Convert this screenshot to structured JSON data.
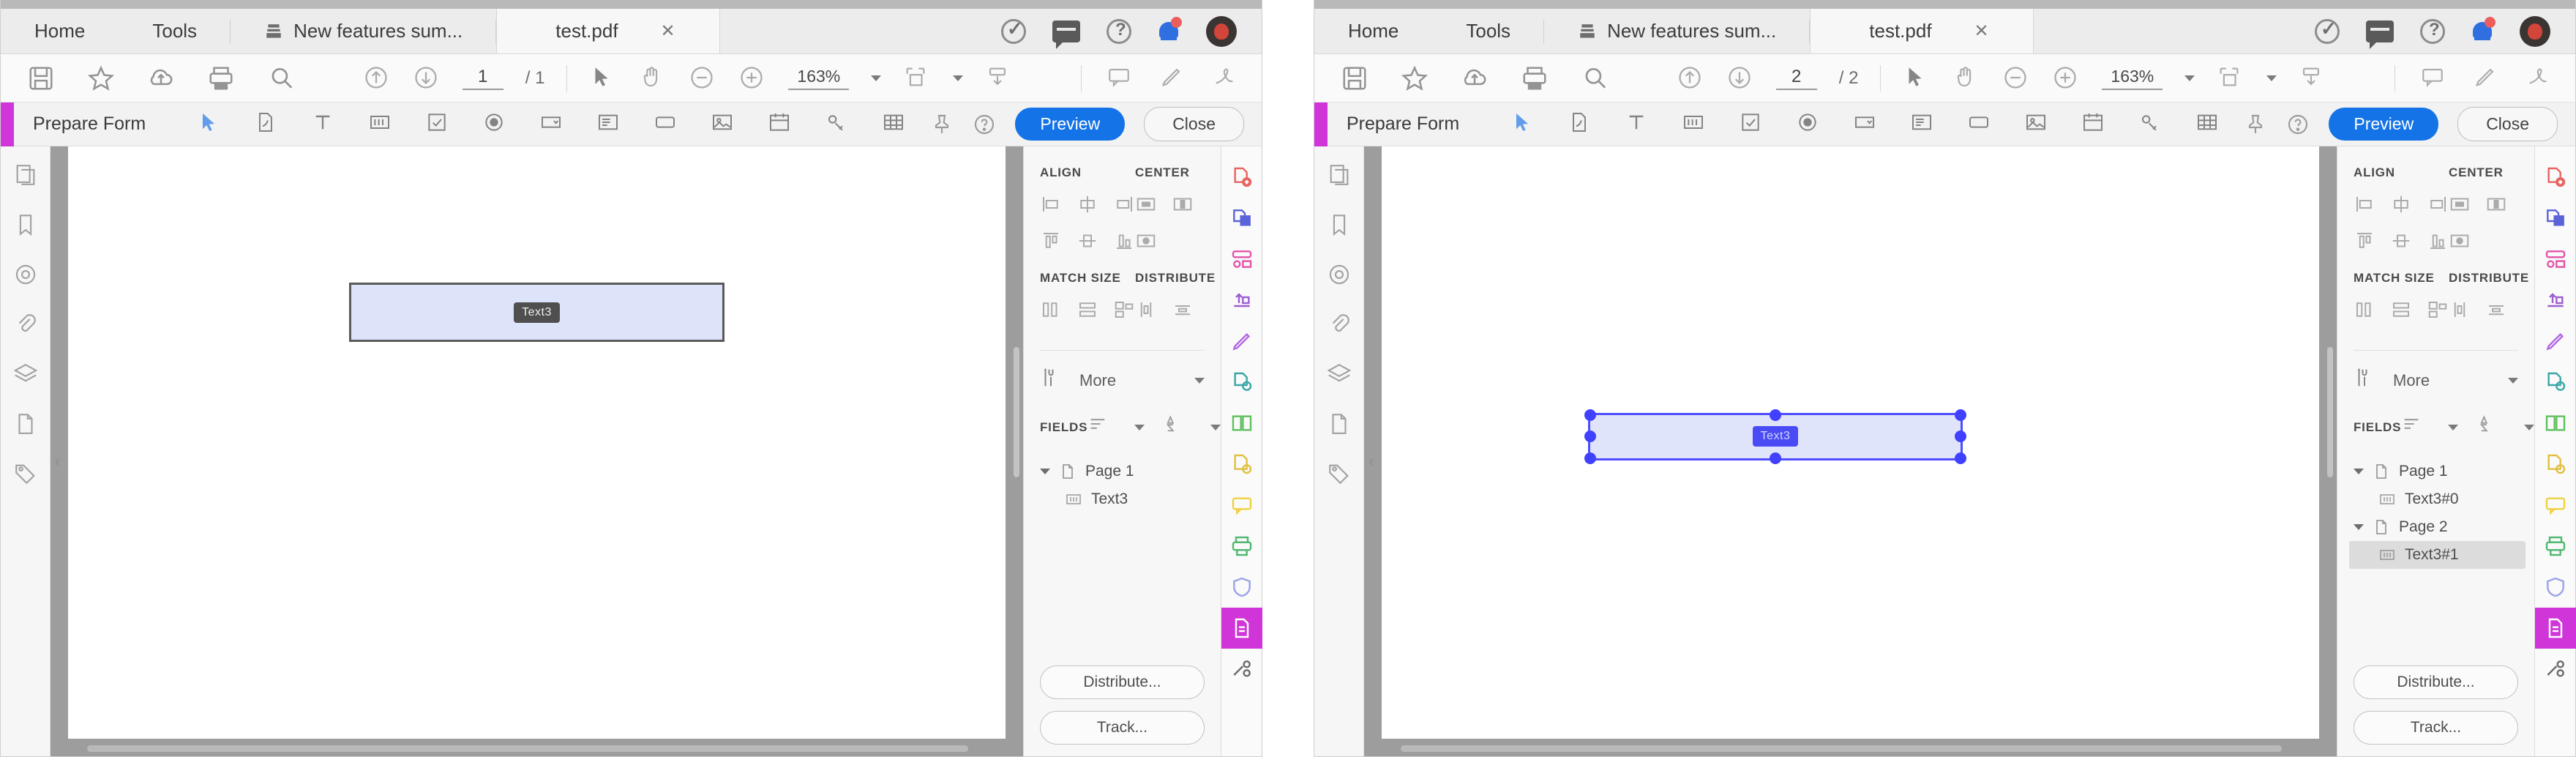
{
  "app": {
    "accent_color": "#cf35d8",
    "primary_button_color": "#1473e6"
  },
  "panels": [
    {
      "id": "panel-left",
      "tabs": {
        "home": "Home",
        "tools": "Tools",
        "recent": "New features sum...",
        "document": "test.pdf",
        "close_glyph": "✕"
      },
      "toolbar": {
        "page_current": "1",
        "page_total": "/ 1",
        "zoom_level": "163%"
      },
      "prepare_form": {
        "title": "Prepare Form",
        "preview_label": "Preview",
        "close_label": "Close"
      },
      "document": {
        "field_tooltip": "Text3",
        "field_selected": false
      },
      "right_panel": {
        "align_header": "ALIGN",
        "center_header": "CENTER",
        "match_size_header": "MATCH SIZE",
        "distribute_header": "DISTRIBUTE",
        "more_label": "More",
        "fields_header": "FIELDS",
        "tree": [
          {
            "label": "Page 1",
            "type": "page",
            "selected": false
          },
          {
            "label": "Text3",
            "type": "field",
            "selected": false
          }
        ],
        "distribute_button": "Distribute...",
        "track_button": "Track..."
      }
    },
    {
      "id": "panel-right",
      "tabs": {
        "home": "Home",
        "tools": "Tools",
        "recent": "New features sum...",
        "document": "test.pdf",
        "close_glyph": "✕"
      },
      "toolbar": {
        "page_current": "2",
        "page_total": "/ 2",
        "zoom_level": "163%"
      },
      "prepare_form": {
        "title": "Prepare Form",
        "preview_label": "Preview",
        "close_label": "Close"
      },
      "document": {
        "field_tooltip": "Text3",
        "field_selected": true
      },
      "right_panel": {
        "align_header": "ALIGN",
        "center_header": "CENTER",
        "match_size_header": "MATCH SIZE",
        "distribute_header": "DISTRIBUTE",
        "more_label": "More",
        "fields_header": "FIELDS",
        "tree": [
          {
            "label": "Page 1",
            "type": "page",
            "selected": false
          },
          {
            "label": "Text3#0",
            "type": "field",
            "selected": false
          },
          {
            "label": "Page 2",
            "type": "page",
            "selected": false
          },
          {
            "label": "Text3#1",
            "type": "field",
            "selected": true
          }
        ],
        "distribute_button": "Distribute...",
        "track_button": "Track..."
      }
    }
  ],
  "rail_colors": [
    "#e8645f",
    "#5a63d8",
    "#e254a8",
    "#9b5fd0",
    "#b066e0",
    "#3aa6a6",
    "#5fc05f",
    "#e0c040",
    "#f0d040",
    "#4fb870",
    "#9aa4e8",
    "#ffffff",
    "#6a6a6a"
  ]
}
